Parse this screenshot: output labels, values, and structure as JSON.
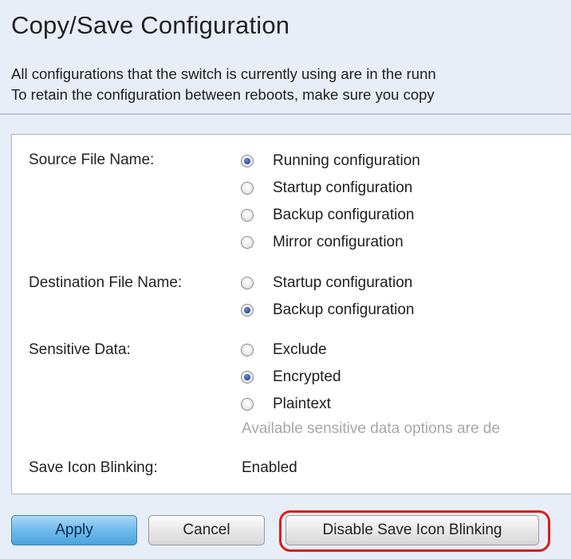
{
  "page": {
    "title": "Copy/Save Configuration",
    "description_line1": "All configurations that the switch is currently using are in the runn",
    "description_line2": "To retain the configuration between reboots, make sure you copy"
  },
  "form": {
    "source": {
      "label": "Source File Name:",
      "options": [
        {
          "label": "Running configuration",
          "checked": true
        },
        {
          "label": "Startup configuration",
          "checked": false
        },
        {
          "label": "Backup configuration",
          "checked": false
        },
        {
          "label": "Mirror configuration",
          "checked": false
        }
      ]
    },
    "destination": {
      "label": "Destination File Name:",
      "options": [
        {
          "label": "Startup configuration",
          "checked": false
        },
        {
          "label": "Backup configuration",
          "checked": true
        }
      ]
    },
    "sensitive": {
      "label": "Sensitive Data:",
      "options": [
        {
          "label": "Exclude",
          "checked": false
        },
        {
          "label": "Encrypted",
          "checked": true
        },
        {
          "label": "Plaintext",
          "checked": false
        }
      ],
      "note": "Available sensitive data options are de"
    },
    "save_icon": {
      "label": "Save Icon Blinking:",
      "value": "Enabled"
    }
  },
  "buttons": {
    "apply": "Apply",
    "cancel": "Cancel",
    "disable_blinking": "Disable Save Icon Blinking"
  },
  "colors": {
    "highlight": "#e01b1b",
    "apply_button": "#6fbbec",
    "page_background": "#e8eef7"
  }
}
